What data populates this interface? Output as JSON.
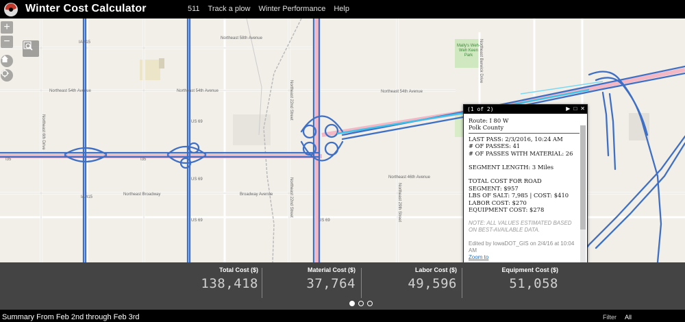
{
  "app": {
    "title": "Winter Cost Calculator",
    "nav": [
      "511",
      "Track a plow",
      "Winter Performance",
      "Help"
    ]
  },
  "map": {
    "zoom_in": "+",
    "zoom_out": "−",
    "labels": {
      "ne58": "Northeast 58th Avenue",
      "ne54_left": "Northeast 54th Avenue",
      "ne54_right": "Northeast 54th Avenue",
      "ne46": "Northeast 46th Avenue",
      "ne_broadway": "Northeast Broadway",
      "broadway": "Broadway Avenue",
      "ne22": "Northeast 22nd Street",
      "ne22b": "Northeast 22nd Street",
      "ne29": "Northeast 29th Street",
      "ne6": "Northeast 6th Drive",
      "berwick": "Northeast Berwick Drive",
      "park": "Mally's Weh-Weh Keen Park",
      "i35": "I35",
      "i35b": "I35",
      "us69a": "US 69",
      "us69b": "US 69",
      "us69c": "US 69",
      "us69d": "US 69",
      "ia415": "IA 415",
      "ia415b": "IA 415"
    }
  },
  "popup": {
    "count": "(1 of 2)",
    "route": "Route: I 80 W",
    "county": "Polk County",
    "last_pass": "LAST PASS: 2/3/2016, 10:24 AM",
    "passes": "# OF PASSES: 41",
    "passes_material": "# OF PASSES WITH MATERIAL: 26",
    "segment_length": "SEGMENT LENGTH: 3 Miles",
    "total_cost_1": "TOTAL COST FOR ROAD",
    "total_cost_2": "SEGMENT: $957",
    "salt": "LBS OF SALT: 7,985 | COST: $410",
    "labor": "LABOR COST: $270",
    "equipment": "EQUIPMENT COST: $278",
    "note": "NOTE: ALL VALUES ESTIMATED BASED ON BEST-AVAILABLE DATA.",
    "edited": "Edited by IowaDOT_GIS on 2/4/16 at 10:04 AM",
    "zoom_to": "Zoom to"
  },
  "summary": {
    "stats": [
      {
        "label": "Total Cost ($)",
        "value": "138,418"
      },
      {
        "label": "Material Cost ($)",
        "value": "37,764"
      },
      {
        "label": "Labor Cost ($)",
        "value": "49,596"
      },
      {
        "label": "Equipment Cost ($)",
        "value": "51,058"
      }
    ],
    "page_count": 3,
    "current_page": 1
  },
  "footer": {
    "summary": "Summary From Feb 2nd through Feb 3rd",
    "filter": "Filter",
    "all": "All"
  },
  "colors": {
    "route": "#3f6fc4",
    "route_active": "#3fc3e8",
    "map_bg": "#f2efe9",
    "park": "#cfe8bf"
  }
}
